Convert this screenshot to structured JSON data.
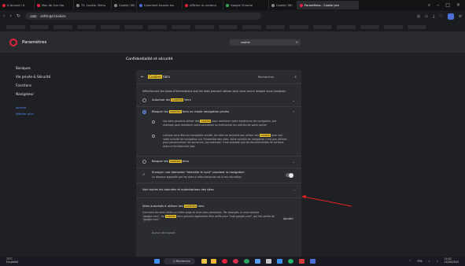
{
  "browser": {
    "tabs": [
      {
        "label": "X Accueil / X",
        "color": "#e5213b"
      },
      {
        "label": "Mon de Sun Hip",
        "color": "#e5213b"
      },
      {
        "label": "TS, Cookie, Menu",
        "color": "#888888"
      },
      {
        "label": "Cookie (36)",
        "color": "#888888"
      },
      {
        "label": "Comment trouver les",
        "color": "#4a6fd8"
      },
      {
        "label": "Afficher le contenu",
        "color": "#e5213b"
      },
      {
        "label": "Google Chrome",
        "color": "#34a853"
      },
      {
        "label": "Cookie (36)",
        "color": "#888888"
      },
      {
        "label": "Paramètres - Cookie Jars",
        "color": "#e5213b",
        "active": true
      }
    ],
    "url_tag": "GKE",
    "url": "settings/cookies"
  },
  "header": {
    "title": "Paramètres",
    "search_value": "cookie"
  },
  "sidebar": {
    "items": [
      "Basiques",
      "Vie privée & Sécurité",
      "Fonctions",
      "Navigateur"
    ],
    "links": [
      "Avancé",
      "Afficher plus"
    ]
  },
  "main": {
    "section_title": "Confidentialité et sécurité",
    "card_title_hl": "Cookies",
    "card_title_rest": "tiers",
    "search_label": "Rechercher",
    "description": "Sélectionnez les types d'informations que les sites peuvent utiliser pour vous suivre lorsque vous naviguez.",
    "option1": {
      "pre": "Autoriser les",
      "hl": "cookies",
      "post": "tiers"
    },
    "option2": {
      "pre": "Bloquer les",
      "hl": "cookies",
      "post": "tiers en mode navigation privée"
    },
    "sub_a_pre": "Les sites peuvent utiliser des",
    "sub_a_hl": "cookies",
    "sub_a_post": "pour améliorer votre expérience de navigation, par exemple pour maintenir votre connexion ou mémoriser les articles de votre panier",
    "sub_b_pre": "Lorsque vous êtes en navigation privée, les sites ne peuvent pas utiliser vos",
    "sub_b_hl": "cookies",
    "sub_b_post": "pour voir votre activité de navigation sur l'ensemble des sites. Votre activité de navigation n'est pas utilisée pour personnaliser les annonces, par exemple. Il est possible que les fonctionnalités de certains sites ne fonctionnent pas.",
    "option3": {
      "pre": "Bloquer les",
      "hl": "cookies",
      "post": "tiers"
    },
    "dnt_title": "Envoyer une demande \"Interdire le suivi\" pendant la navigation",
    "dnt_sub": "La réponse apportée par les sites à cette demande est à leur discrétion",
    "all_data": "Voir toutes les données et autorisations des sites",
    "allowed_title_pre": "Sites autorisés à utiliser des",
    "allowed_title_hl": "cookies",
    "allowed_title_post": "tiers",
    "allowed_desc_a": "Concerne les sites listés sur cette page et leurs sous-domaines. Par exemple, si vous ajoutez",
    "allowed_desc_b": "\"google.com\", les",
    "allowed_desc_hl": "cookies",
    "allowed_desc_c": "tiers peuvent également être actifs pour \"mail.google.com\", qui fait",
    "allowed_desc_d": "partie de \"google.com\".",
    "add_button": "Ajouter",
    "no_site": "Aucun site ajouté"
  },
  "taskbar": {
    "left_line1": "13°C",
    "left_line2": "Ensoleillé",
    "search_label": "Q Recherche",
    "tray_lang": "FRA",
    "time": "14:02",
    "date": "24/09/2024"
  }
}
